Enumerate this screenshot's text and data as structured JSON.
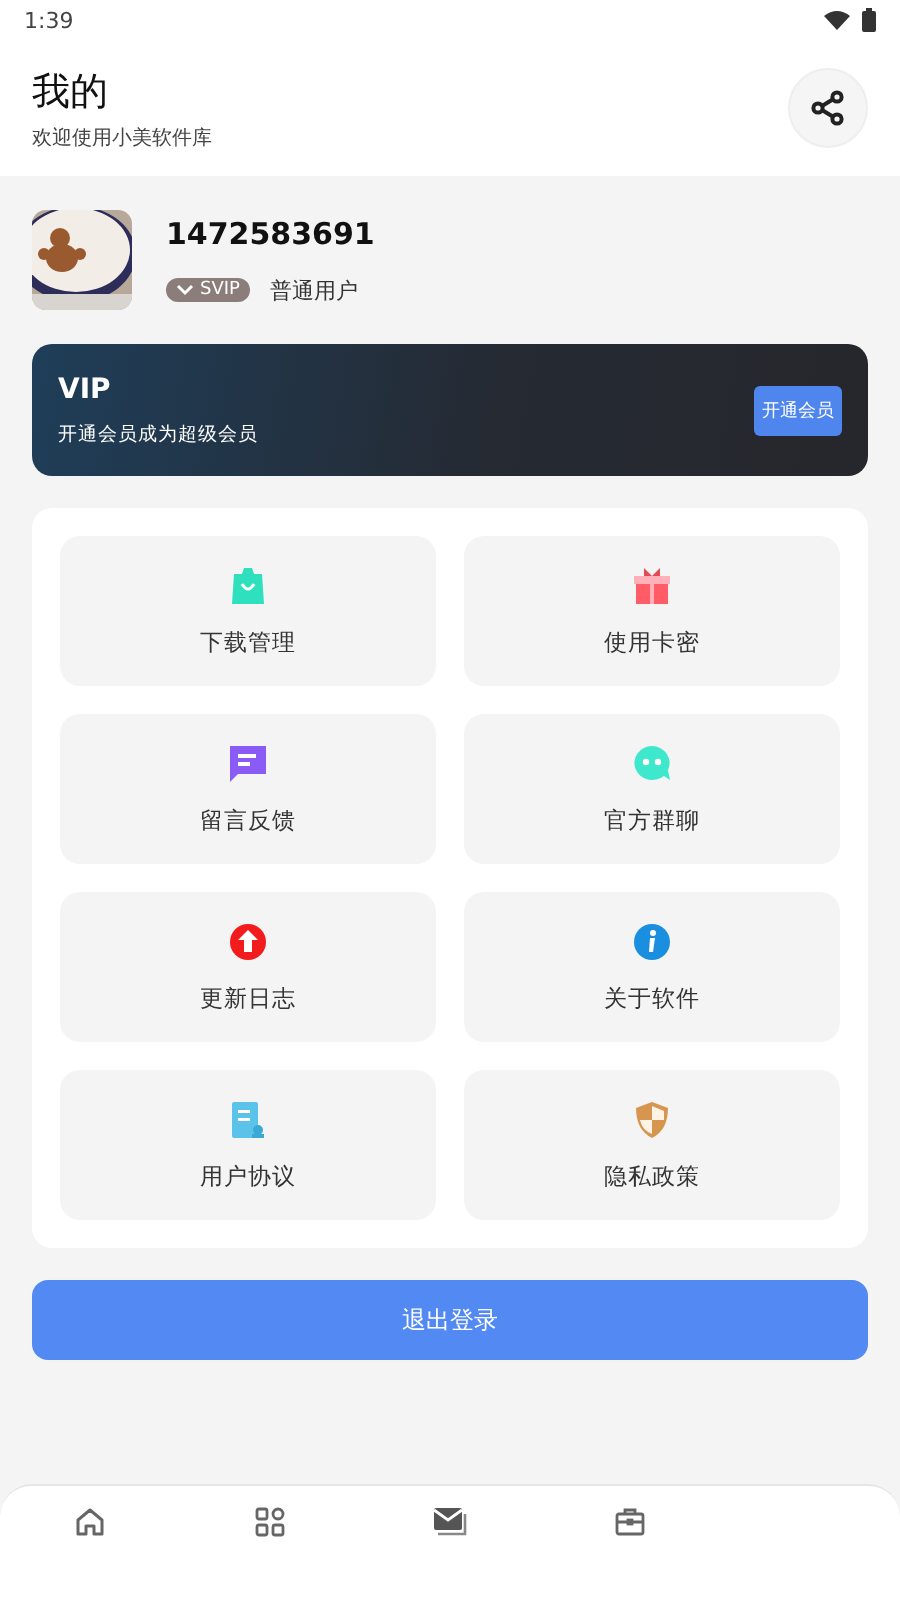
{
  "status_bar": {
    "time": "1:39"
  },
  "header": {
    "title": "我的",
    "subtitle": "欢迎使用小美软件库"
  },
  "profile": {
    "username": "1472583691",
    "badge": "SVIP",
    "role": "普通用户"
  },
  "vip_card": {
    "title": "VIP",
    "text": "开通会员成为超级会员",
    "button": "开通会员"
  },
  "menu": [
    {
      "label": "下载管理",
      "kind": "bag"
    },
    {
      "label": "使用卡密",
      "kind": "gift"
    },
    {
      "label": "留言反馈",
      "kind": "message"
    },
    {
      "label": "官方群聊",
      "kind": "chat"
    },
    {
      "label": "更新日志",
      "kind": "update"
    },
    {
      "label": "关于软件",
      "kind": "info"
    },
    {
      "label": "用户协议",
      "kind": "document"
    },
    {
      "label": "隐私政策",
      "kind": "shield"
    }
  ],
  "logout_button": "退出登录",
  "bottom_nav": [
    {
      "kind": "home"
    },
    {
      "kind": "grid"
    },
    {
      "kind": "mail"
    },
    {
      "kind": "briefcase"
    }
  ]
}
